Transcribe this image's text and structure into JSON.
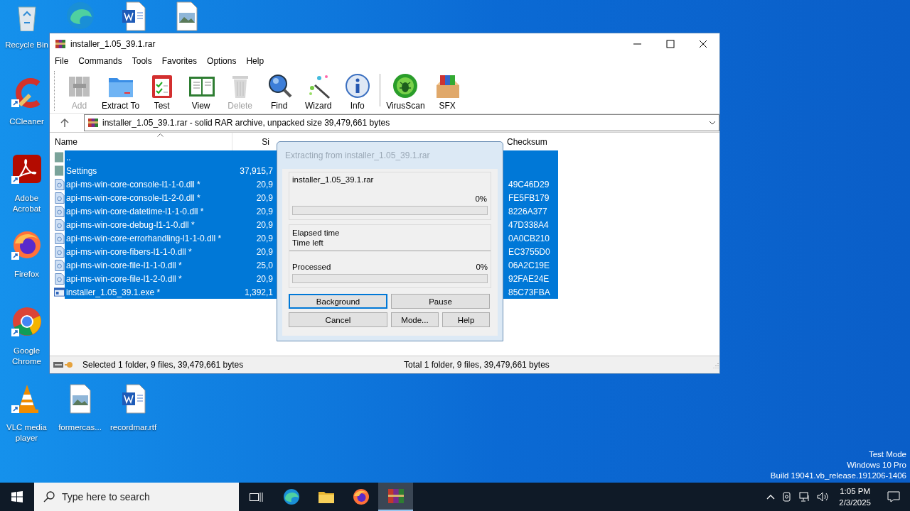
{
  "desktop": {
    "icons": [
      {
        "kind": "recycle",
        "label": "Recycle Bin",
        "shortcut": false
      },
      {
        "kind": "edge",
        "shortcut": false
      },
      {
        "kind": "word",
        "shortcut": false
      },
      {
        "kind": "image",
        "shortcut": false
      },
      {
        "kind": "ccleaner",
        "label": "CCleaner",
        "shortcut": true
      },
      {
        "kind": "acrobat",
        "label": "Adobe Acrobat",
        "shortcut": true
      },
      {
        "kind": "firefox",
        "label": "Firefox",
        "shortcut": true
      },
      {
        "kind": "chrome",
        "label": "Google Chrome",
        "shortcut": true
      },
      {
        "kind": "vlc",
        "label": "VLC media player",
        "shortcut": true
      },
      {
        "kind": "image",
        "label": "formercas...",
        "shortcut": false
      },
      {
        "kind": "word",
        "label": "recordmar.rtf",
        "shortcut": false
      }
    ],
    "system_text": [
      "Test Mode",
      "Windows 10 Pro",
      "Build 19041.vb_release.191206-1406"
    ]
  },
  "window": {
    "title": "installer_1.05_39.1.rar",
    "menu": [
      "File",
      "Commands",
      "Tools",
      "Favorites",
      "Options",
      "Help"
    ],
    "toolbar": [
      {
        "kind": "add",
        "label": "Add",
        "disabled": true
      },
      {
        "kind": "extract",
        "label": "Extract To",
        "disabled": false
      },
      {
        "kind": "test",
        "label": "Test",
        "disabled": false
      },
      {
        "kind": "view",
        "label": "View",
        "disabled": false
      },
      {
        "kind": "delete",
        "label": "Delete",
        "disabled": true
      },
      {
        "kind": "find",
        "label": "Find",
        "disabled": false
      },
      {
        "kind": "wizard",
        "label": "Wizard",
        "disabled": false
      },
      {
        "kind": "info",
        "label": "Info",
        "disabled": false
      },
      {
        "kind": "virus",
        "label": "VirusScan",
        "disabled": false
      },
      {
        "kind": "sfx",
        "label": "SFX",
        "disabled": false
      }
    ],
    "address": "installer_1.05_39.1.rar - solid RAR archive, unpacked size 39,479,661 bytes",
    "columns": {
      "name": "Name",
      "size": "Si",
      "checksum": "Checksum"
    },
    "rows": [
      {
        "kind": "folder",
        "name": "..",
        "selected": true
      },
      {
        "kind": "folder",
        "name": "Settings",
        "size": "37,915,7",
        "selected": true
      },
      {
        "kind": "file",
        "name": "api-ms-win-core-console-l1-1-0.dll *",
        "size": "20,9",
        "checksum": "49C46D29",
        "selected": true
      },
      {
        "kind": "file",
        "name": "api-ms-win-core-console-l1-2-0.dll *",
        "size": "20,9",
        "checksum": "FE5FB179",
        "selected": true
      },
      {
        "kind": "file",
        "name": "api-ms-win-core-datetime-l1-1-0.dll *",
        "size": "20,9",
        "checksum": "8226A377",
        "selected": true
      },
      {
        "kind": "file",
        "name": "api-ms-win-core-debug-l1-1-0.dll *",
        "size": "20,9",
        "checksum": "47D338A4",
        "selected": true
      },
      {
        "kind": "file",
        "name": "api-ms-win-core-errorhandling-l1-1-0.dll *",
        "size": "20,9",
        "checksum": "0A0CB210",
        "selected": true
      },
      {
        "kind": "file",
        "name": "api-ms-win-core-fibers-l1-1-0.dll *",
        "size": "20,9",
        "checksum": "EC3755D0",
        "selected": true
      },
      {
        "kind": "file",
        "name": "api-ms-win-core-file-l1-1-0.dll *",
        "size": "25,0",
        "checksum": "06A2C19E",
        "selected": true
      },
      {
        "kind": "file",
        "name": "api-ms-win-core-file-l1-2-0.dll *",
        "size": "20,9",
        "checksum": "92FAE24E",
        "selected": true
      },
      {
        "kind": "exe",
        "name": "installer_1.05_39.1.exe *",
        "size": "1,392,1",
        "checksum": "85C73FBA",
        "selected": true
      }
    ],
    "status": [
      "Selected 1 folder, 9 files, 39,479,661 bytes",
      "Total 1 folder, 9 files, 39,479,661 bytes"
    ]
  },
  "dialog": {
    "title": "Extracting from installer_1.05_39.1.rar",
    "archive": "installer_1.05_39.1.rar",
    "archive_percent": "0%",
    "archive_progress": {
      "level": 0
    },
    "times": [
      "Elapsed time",
      "Time left"
    ],
    "processed": "Processed",
    "processed_percent": "0%",
    "processed_progress": {
      "level": 0
    },
    "buttons": [
      {
        "label": "Background",
        "focused": true
      },
      {
        "label": "Pause",
        "focused": false
      },
      {
        "label": "Cancel",
        "focused": false
      },
      {
        "label": "Mode...",
        "focused": false
      },
      {
        "label": "Help",
        "focused": false
      }
    ]
  },
  "taskbar": {
    "search_placeholder": "Type here to search",
    "apps": [
      {
        "kind": "taskview",
        "active": false
      },
      {
        "kind": "edge",
        "active": false
      },
      {
        "kind": "explorer",
        "active": false
      },
      {
        "kind": "firefox",
        "active": false
      },
      {
        "kind": "winrar",
        "active": true
      }
    ],
    "time": "1:05 PM",
    "date": "2/3/2025"
  }
}
